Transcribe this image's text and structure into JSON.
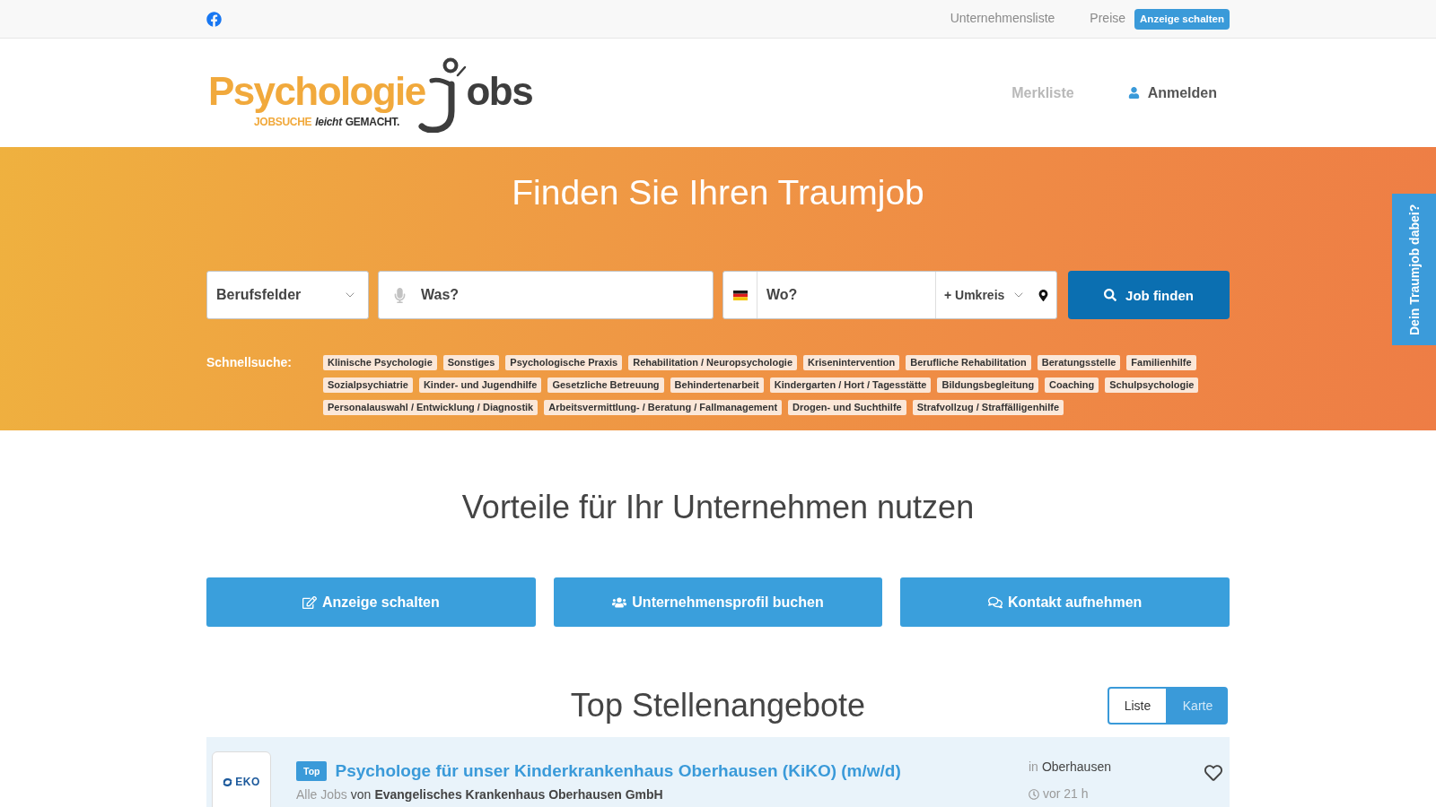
{
  "top_bar": {
    "links": [
      {
        "label": "Unternehmensliste"
      },
      {
        "label": "Preise"
      }
    ],
    "cta": "Anzeige schalten"
  },
  "header": {
    "logo": {
      "name_start": "Psychologie",
      "name_end": "obs",
      "tagline": [
        {
          "text": "JOBSUCHE",
          "kind": "accent"
        },
        {
          "text": "leicht",
          "kind": "italic"
        },
        {
          "text": "GEMACHT.",
          "kind": "plain"
        }
      ]
    },
    "nav": [
      {
        "label": "Merkliste",
        "kind": "plain",
        "disabled": true
      },
      {
        "label": "Anmelden",
        "kind": "account",
        "disabled": false
      }
    ]
  },
  "hero": {
    "title": "Finden Sie Ihren Traumjob",
    "search": {
      "category": {
        "value": "Berufsfelder"
      },
      "what": {
        "placeholder": "Was?"
      },
      "where": {
        "placeholder": "Wo?"
      },
      "radius": {
        "value": "+ Umkreis"
      },
      "submit": "Job finden"
    },
    "quick_search": {
      "label": "Schnellsuche:",
      "tags": [
        "Klinische Psychologie",
        "Sonstiges",
        "Psychologische Praxis",
        "Rehabilitation / Neuropsychologie",
        "Krisenintervention",
        "Berufliche Rehabilitation",
        "Beratungsstelle",
        "Familienhilfe",
        "Sozialpsychiatrie",
        "Kinder- und Jugendhilfe",
        "Gesetzliche Betreuung",
        "Behindertenarbeit",
        "Kindergarten / Hort / Tagesstätte",
        "Bildungsbegleitung",
        "Coaching",
        "Schulpsychologie",
        "Personalauswahl / Entwicklung / Diagnostik",
        "Arbeitsvermittlung- / Beratung / Fallmanagement",
        "Drogen- und Suchthilfe",
        "Strafvollzug / Straffälligenhilfe"
      ]
    }
  },
  "side_tab": {
    "label": "Dein Traumjob dabei?"
  },
  "benefits": {
    "title": "Vorteile für Ihr Unternehmen nutzen",
    "buttons": [
      {
        "label": "Anzeige schalten",
        "kind": "edit"
      },
      {
        "label": "Unternehmensprofil buchen",
        "kind": "users"
      },
      {
        "label": "Kontakt aufnehmen",
        "kind": "chat"
      }
    ]
  },
  "top_jobs": {
    "title": "Top Stellenangebote",
    "view_tabs": [
      {
        "label": "Liste",
        "selected": true
      },
      {
        "label": "Karte",
        "selected": false
      }
    ],
    "jobs": [
      {
        "logo_text": "EKO",
        "badge": "Top",
        "title": "Psychologe für unser Kinderkrankenhaus Oberhausen (KiKO) (m/w/d)",
        "all_jobs_link": "Alle Jobs",
        "by": "von",
        "company": "Evangelisches Krankenhaus Oberhausen GmbH",
        "location_prefix": "in",
        "location": "Oberhausen",
        "posted": "vor 21 h",
        "saved": false
      }
    ]
  }
}
